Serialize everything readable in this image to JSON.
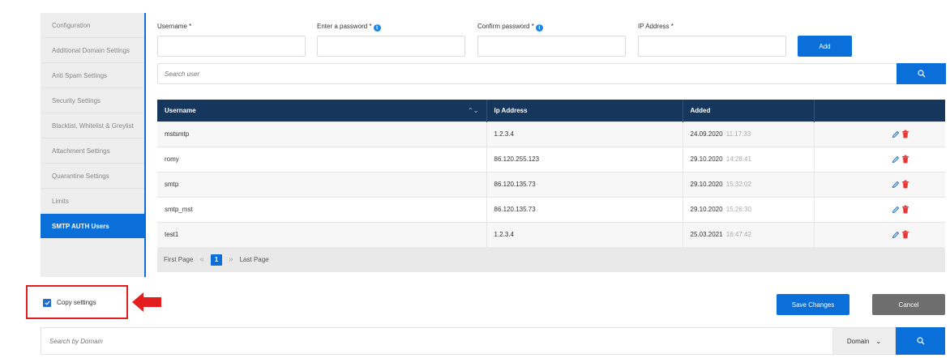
{
  "sidebar": {
    "items": [
      {
        "label": "Configuration"
      },
      {
        "label": "Additional Domain Settings"
      },
      {
        "label": "Anti Spam Settings"
      },
      {
        "label": "Security Settings"
      },
      {
        "label": "Blacklist, Whitelist & Greylist"
      },
      {
        "label": "Attachment Settings"
      },
      {
        "label": "Quarantine Settings"
      },
      {
        "label": "Limits"
      },
      {
        "label": "SMTP AUTH Users",
        "active": true
      }
    ]
  },
  "form": {
    "username_label": "Username *",
    "password_label": "Enter a password *",
    "confirm_label": "Confirm password *",
    "ip_label": "IP Address *",
    "username_value": "",
    "password_value": "",
    "confirm_value": "",
    "ip_value": "",
    "add_label": "Add",
    "info_icon": "info-icon"
  },
  "search_user": {
    "placeholder": "Search user",
    "icon": "search-icon"
  },
  "table": {
    "columns": [
      "Username",
      "Ip Address",
      "Added",
      ""
    ],
    "rows": [
      {
        "username": "mstsmtp",
        "ip": "1.2.3.4",
        "date": "24.09.2020",
        "time": "11:17:33"
      },
      {
        "username": "romy",
        "ip": "86.120.255.123",
        "date": "29.10.2020",
        "time": "14:28:41"
      },
      {
        "username": "smtp",
        "ip": "86.120.135.73",
        "date": "29.10.2020",
        "time": "15:32:02"
      },
      {
        "username": "smtp_mst",
        "ip": "86.120.135.73",
        "date": "29.10.2020",
        "time": "15:26:30"
      },
      {
        "username": "test1",
        "ip": "1.2.3.4",
        "date": "25.03.2021",
        "time": "16:47:42"
      }
    ]
  },
  "pager": {
    "first": "First Page",
    "prev": "«",
    "current": "1",
    "next": "»",
    "last": "Last Page"
  },
  "copy_settings": {
    "label": "Copy settings",
    "checked": true
  },
  "actions": {
    "save_label": "Save Changes",
    "cancel_label": "Cancel"
  },
  "domain_search": {
    "placeholder": "Search by Domain",
    "select_value": "Domain",
    "chevron": "⌄"
  },
  "colors": {
    "accent": "#0a6fd8",
    "table_header": "#15375d",
    "highlight": "#e41e1e",
    "cancel": "#6e6e6e"
  }
}
